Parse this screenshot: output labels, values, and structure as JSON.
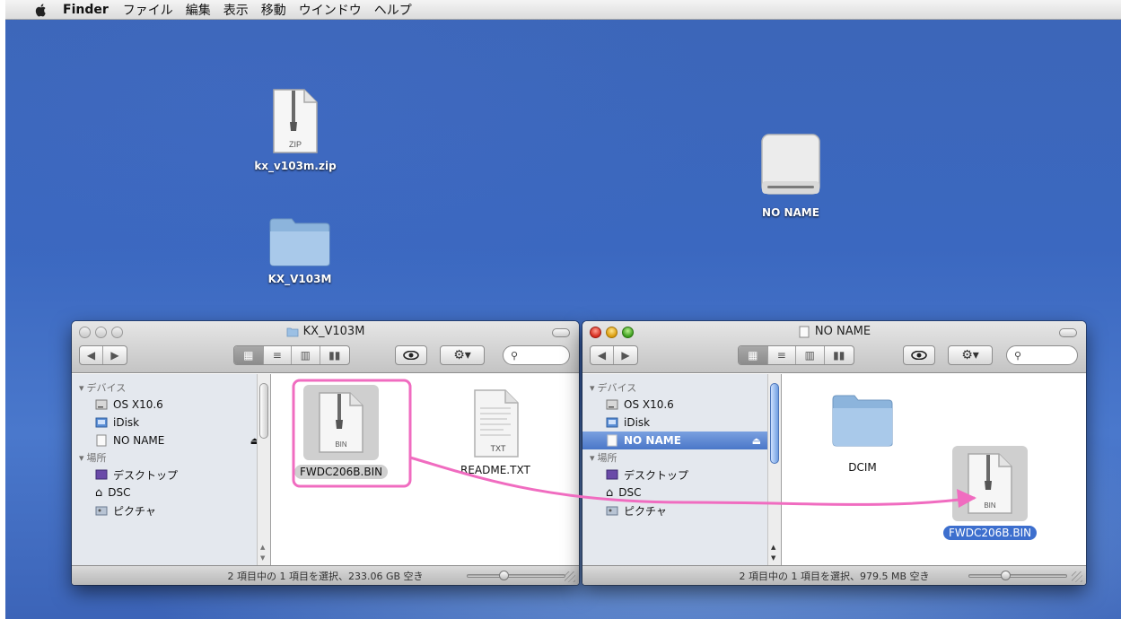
{
  "menubar": {
    "app": "Finder",
    "items": [
      "ファイル",
      "編集",
      "表示",
      "移動",
      "ウインドウ",
      "ヘルプ"
    ]
  },
  "desktop": {
    "zip": {
      "label": "kx_v103m.zip",
      "badge": "ZIP"
    },
    "folder": {
      "label": "KX_V103M"
    },
    "volume": {
      "label": "NO NAME"
    }
  },
  "left_window": {
    "title": "KX_V103M",
    "sidebar": {
      "devices_header": "デバイス",
      "devices": [
        "OS X10.6",
        "iDisk",
        "NO NAME"
      ],
      "places_header": "場所",
      "places": [
        "デスクトップ",
        "DSC",
        "ピクチャ"
      ]
    },
    "files": [
      {
        "name": "FWDC206B.BIN",
        "badge": "BIN"
      },
      {
        "name": "README.TXT",
        "badge": "TXT"
      }
    ],
    "status": "2 項目中の 1 項目を選択、233.06 GB 空き"
  },
  "right_window": {
    "title": "NO NAME",
    "sidebar": {
      "devices_header": "デバイス",
      "devices": [
        "OS X10.6",
        "iDisk",
        "NO NAME"
      ],
      "places_header": "場所",
      "places": [
        "デスクトップ",
        "DSC",
        "ピクチャ"
      ]
    },
    "files": [
      {
        "name": "DCIM"
      },
      {
        "name": "FWDC206B.BIN",
        "badge": "BIN"
      }
    ],
    "status": "2 項目中の 1 項目を選択、979.5 MB 空き"
  },
  "colors": {
    "annotation": "#f06cc0",
    "selection": "#3d6fce"
  }
}
